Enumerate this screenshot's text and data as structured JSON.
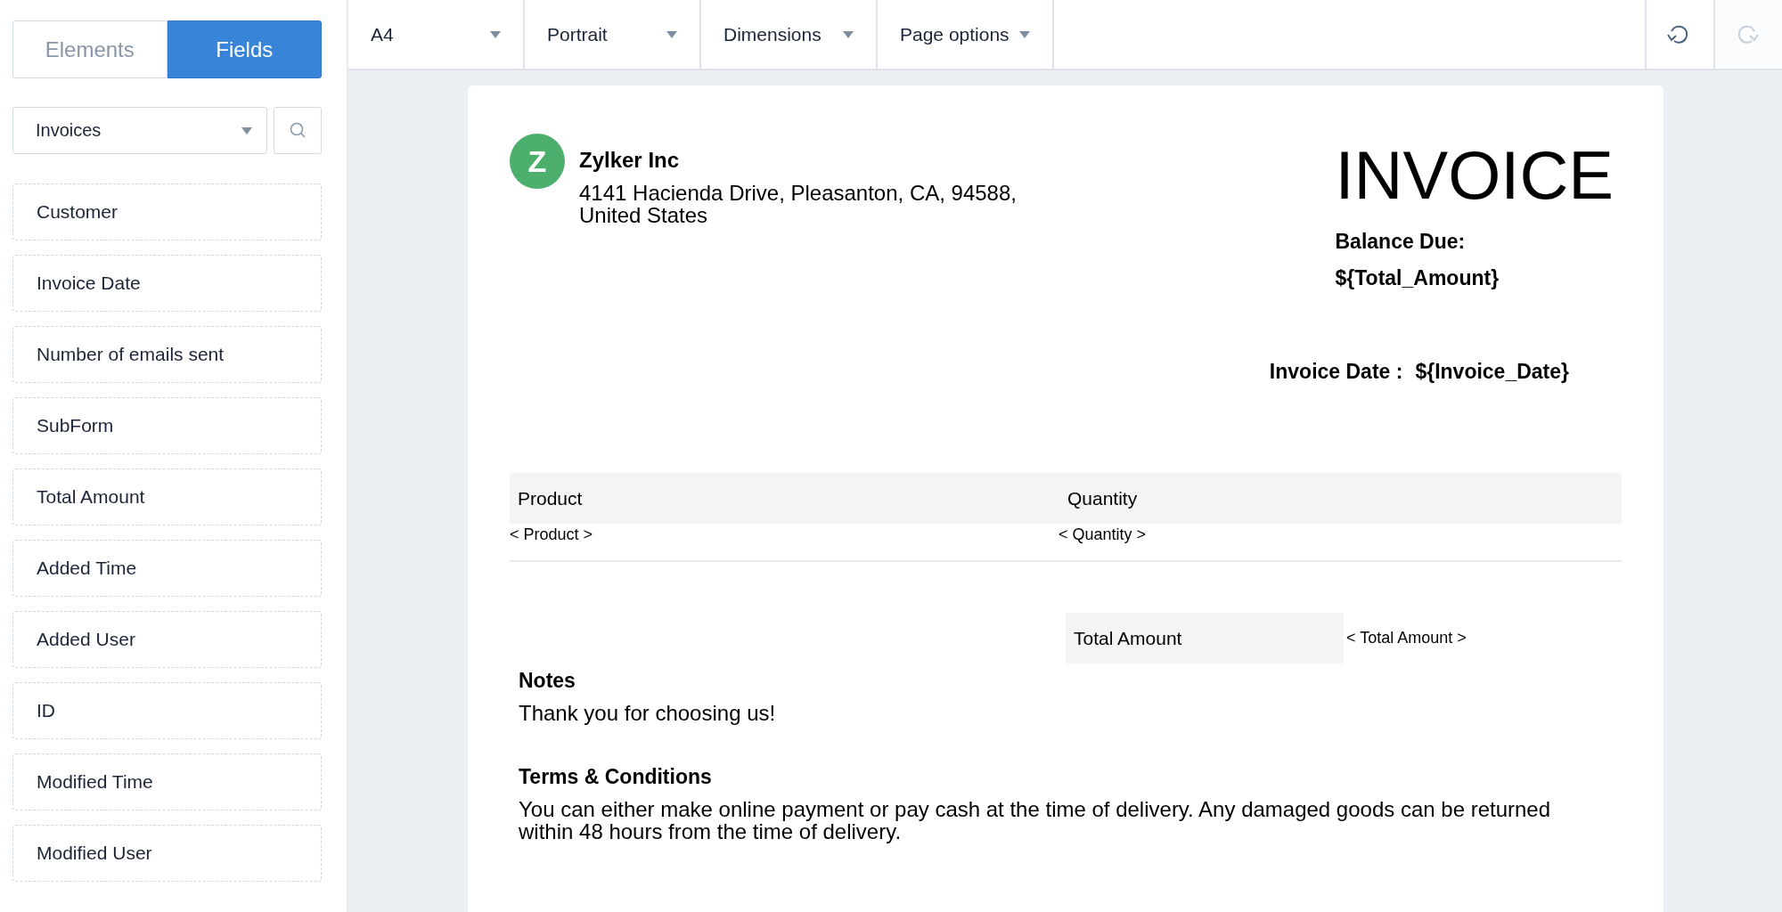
{
  "sidebar": {
    "tabs": [
      {
        "label": "Elements",
        "selected": false
      },
      {
        "label": "Fields",
        "selected": true
      }
    ],
    "form_select": {
      "value": "Invoices"
    },
    "fields": [
      {
        "label": "Customer"
      },
      {
        "label": "Invoice Date"
      },
      {
        "label": "Number of emails sent"
      },
      {
        "label": "SubForm"
      },
      {
        "label": "Total Amount"
      },
      {
        "label": "Added Time"
      },
      {
        "label": "Added User"
      },
      {
        "label": "ID"
      },
      {
        "label": "Modified Time"
      },
      {
        "label": "Modified User"
      }
    ]
  },
  "toolbar": {
    "dropdowns": [
      {
        "label": "A4"
      },
      {
        "label": "Portrait"
      },
      {
        "label": "Dimensions"
      },
      {
        "label": "Page options"
      }
    ],
    "actions": [
      {
        "kind": "undo",
        "disabled": false
      },
      {
        "kind": "redo",
        "disabled": true
      }
    ]
  },
  "document": {
    "logo_letter": "Z",
    "company": "Zylker Inc",
    "address": "4141 Hacienda Drive, Pleasanton, CA, 94588,\nUnited States",
    "title": "INVOICE",
    "balance_label": "Balance Due:",
    "balance_value": "${Total_Amount}",
    "date_label": "Invoice Date :",
    "date_value": "${Invoice_Date}",
    "table": {
      "columns": [
        "Product",
        "Quantity"
      ],
      "rows": [
        [
          "< Product >",
          "< Quantity >"
        ]
      ]
    },
    "total": {
      "label": "Total Amount",
      "value": "< Total Amount >"
    },
    "notes": {
      "heading": "Notes",
      "text": "Thank you for choosing us!"
    },
    "terms": {
      "heading": "Terms & Conditions",
      "text": "You can either make online payment or pay cash at the time of delivery. Any damaged goods can be returned within 48 hours from the time of delivery."
    }
  }
}
